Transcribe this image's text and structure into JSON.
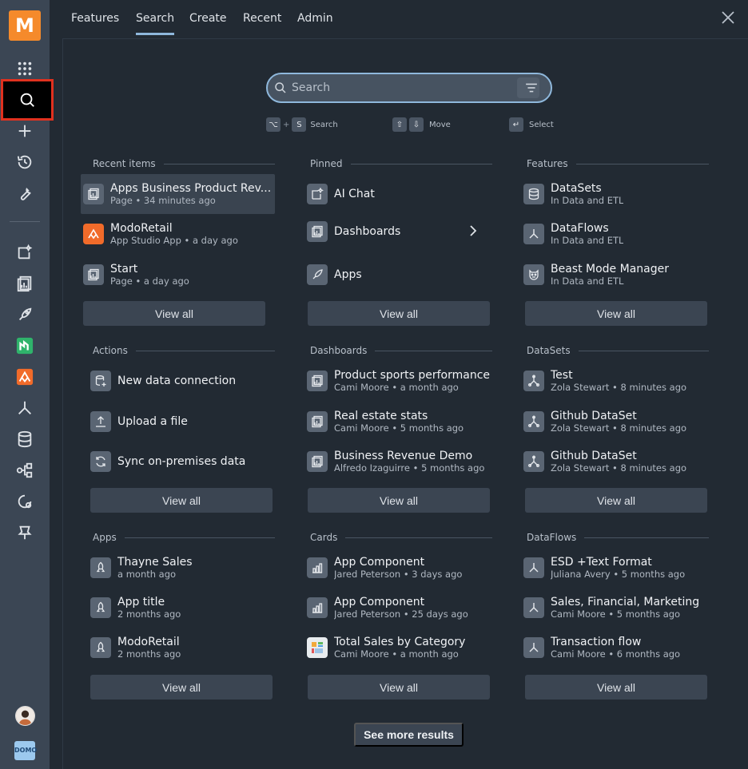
{
  "logo": {
    "letter": "M"
  },
  "nav": {
    "tabs": [
      {
        "label": "Features"
      },
      {
        "label": "Search"
      },
      {
        "label": "Create"
      },
      {
        "label": "Recent"
      },
      {
        "label": "Admin"
      }
    ],
    "active_tab": "Search"
  },
  "search": {
    "placeholder": "Search"
  },
  "hints": {
    "search_keys": [
      "⌥",
      "S"
    ],
    "search_label": "Search",
    "move_keys": [
      "⇧",
      "⇩"
    ],
    "move_label": "Move",
    "select_key": "↵",
    "select_label": "Select"
  },
  "sections": {
    "recent": {
      "header": "Recent items",
      "items": [
        {
          "title": "Apps Business Product Rev...",
          "sub": "Page • 34 minutes ago"
        },
        {
          "title": "ModoRetail",
          "sub": "App Studio App • a day ago"
        },
        {
          "title": "Start",
          "sub": "Page • a day ago"
        }
      ],
      "view_all": "View all"
    },
    "pinned": {
      "header": "Pinned",
      "items": [
        {
          "title": "AI Chat"
        },
        {
          "title": "Dashboards"
        },
        {
          "title": "Apps"
        }
      ],
      "view_all": "View all"
    },
    "features": {
      "header": "Features",
      "items": [
        {
          "title": "DataSets",
          "sub": "In Data and ETL"
        },
        {
          "title": "DataFlows",
          "sub": "In Data and ETL"
        },
        {
          "title": "Beast Mode Manager",
          "sub": "In Data and ETL"
        }
      ],
      "view_all": "View all"
    },
    "actions": {
      "header": "Actions",
      "items": [
        {
          "title": "New data connection"
        },
        {
          "title": "Upload a file"
        },
        {
          "title": "Sync on-premises data"
        }
      ],
      "view_all": "View all"
    },
    "dashboards": {
      "header": "Dashboards",
      "items": [
        {
          "title": "Product sports performance",
          "sub": "Cami Moore • a month ago"
        },
        {
          "title": "Real estate stats",
          "sub": "Cami Moore • 5 months ago"
        },
        {
          "title": "Business Revenue Demo",
          "sub": "Alfredo Izaguirre • 5 months ago"
        }
      ],
      "view_all": "View all"
    },
    "datasets": {
      "header": "DataSets",
      "items": [
        {
          "title": "Test",
          "sub": "Zola Stewart • 8 minutes ago"
        },
        {
          "title": "Github DataSet",
          "sub": "Zola Stewart • 8 minutes ago"
        },
        {
          "title": "Github DataSet",
          "sub": "Zola Stewart • 8 minutes ago"
        }
      ],
      "view_all": "View all"
    },
    "apps": {
      "header": "Apps",
      "items": [
        {
          "title": "Thayne Sales",
          "sub": "a month ago"
        },
        {
          "title": "App title",
          "sub": "2 months ago"
        },
        {
          "title": "ModoRetail",
          "sub": "2 months ago"
        }
      ],
      "view_all": "View all"
    },
    "cards": {
      "header": "Cards",
      "items": [
        {
          "title": "App Component",
          "sub": "Jared Peterson • 3 days ago"
        },
        {
          "title": "App Component",
          "sub": "Jared Peterson • 25 days ago"
        },
        {
          "title": "Total Sales by Category",
          "sub": "Cami Moore • a month ago"
        }
      ],
      "view_all": "View all"
    },
    "dataflows": {
      "header": "DataFlows",
      "items": [
        {
          "title": "ESD +Text Format",
          "sub": "Juliana Avery • 5 months ago"
        },
        {
          "title": "Sales, Financial, Marketing",
          "sub": "Cami Moore • 5 months ago"
        },
        {
          "title": "Transaction flow",
          "sub": "Cami Moore • 6 months ago"
        }
      ],
      "view_all": "View all"
    }
  },
  "see_more": "See more results",
  "footer": {
    "badge": "DOMO"
  },
  "colors": {
    "accent": "#8fb8dc",
    "brand": "#f58a2b",
    "highlight": "#e0311f"
  }
}
